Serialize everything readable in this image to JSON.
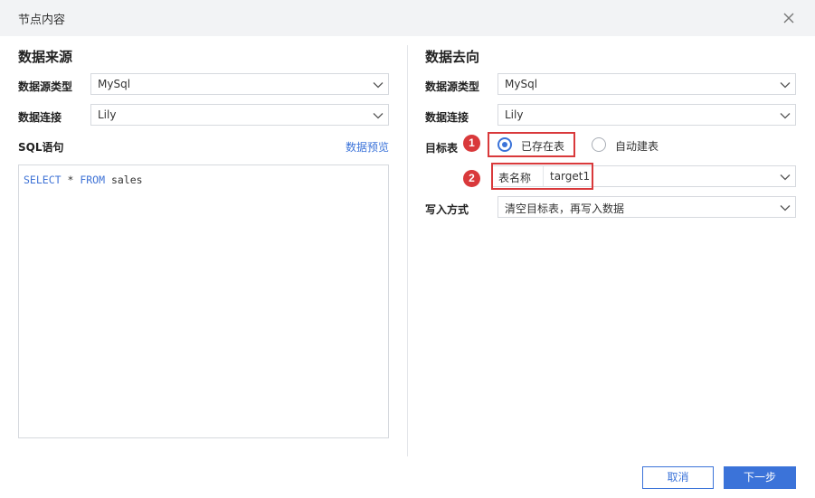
{
  "dialog": {
    "title": "节点内容",
    "close_icon": "close-icon"
  },
  "source": {
    "section_title": "数据来源",
    "type_label": "数据源类型",
    "type_value": "MySql",
    "conn_label": "数据连接",
    "conn_value": "Lily",
    "sql_label": "SQL语句",
    "preview_link": "数据预览",
    "sql": {
      "kw1": "SELECT",
      "t1": " * ",
      "kw2": "FROM",
      "t2": " sales"
    }
  },
  "target": {
    "section_title": "数据去向",
    "type_label": "数据源类型",
    "type_value": "MySql",
    "conn_label": "数据连接",
    "conn_value": "Lily",
    "table_label": "目标表",
    "radio_existing": "已存在表",
    "radio_auto": "自动建表",
    "table_name_label": "表名称",
    "table_name_value": "target1",
    "write_label": "写入方式",
    "write_value": "清空目标表，再写入数据"
  },
  "annotations": {
    "badge1": "1",
    "badge2": "2"
  },
  "buttons": {
    "cancel": "取消",
    "next": "下一步"
  },
  "colors": {
    "accent": "#3b73d9",
    "annotation_red": "#d9393b",
    "header_bg": "#f2f3f5"
  }
}
